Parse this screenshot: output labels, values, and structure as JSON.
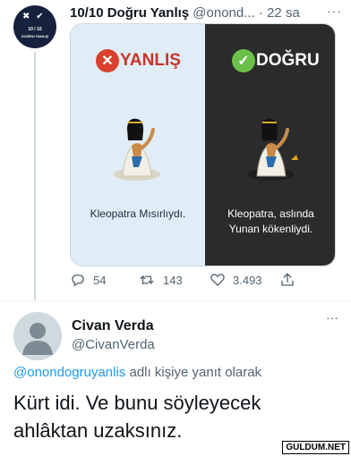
{
  "tweet": {
    "author_name": "10/10 Doğru Yanlış",
    "author_handle": "@onond...",
    "separator": "·",
    "time": "22 sa",
    "more": "···",
    "avatar": {
      "icons": "✖ ✔",
      "score": "10 / 10",
      "brand": "DOĞRU YANLIŞ"
    },
    "card": {
      "left_label": "YANLIŞ",
      "right_label": "DOĞRU",
      "left_caption": "Kleopatra Mısırlıydı.",
      "right_caption_line1": "Kleopatra, aslında",
      "right_caption_line2": "Yunan kökenliydi.",
      "left_bg": "#e1edf6",
      "right_bg": "#2b2b2b",
      "wrong_color": "#d9412c",
      "right_color": "#6cc04a"
    },
    "actions": {
      "replies": "54",
      "retweets": "143",
      "likes": "3.493"
    }
  },
  "reply": {
    "author_name": "Civan Verda",
    "author_handle": "@CivanVerda",
    "more": "···",
    "replying_mention": "@onondogruyanlis",
    "replying_suffix": " adlı kişiye yanıt olarak",
    "text": "Kürt idi. Ve bunu söyleyecek ahlâktan uzaksınız."
  },
  "watermark": "GULDUM.NET"
}
